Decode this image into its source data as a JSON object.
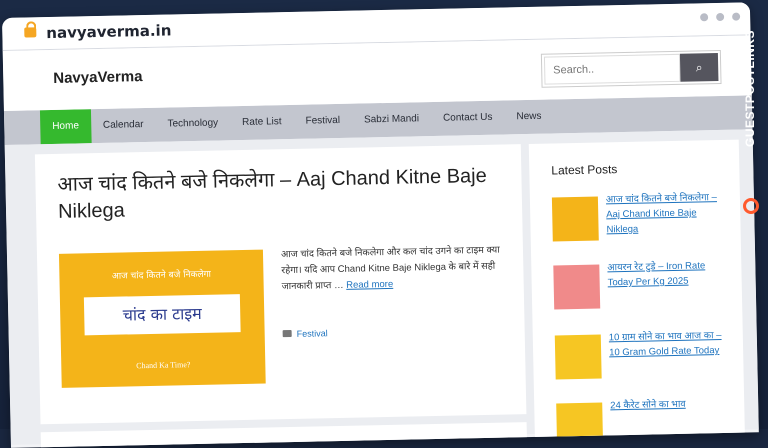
{
  "browser": {
    "url": "navyaverma.in"
  },
  "site": {
    "logo": "NavyaVerma",
    "search_placeholder": "Search..",
    "search_button": "⌕"
  },
  "nav": [
    "Home",
    "Calendar",
    "Technology",
    "Rate List",
    "Festival",
    "Sabzi Mandi",
    "Contact Us",
    "News"
  ],
  "article": {
    "title": "आज चांद कितने बजे निकलेगा – Aaj Chand Kitne Baje Niklega",
    "thumb_small": "आज चांद कितने बजे निकलेगा",
    "thumb_main": "चांद का टाइम",
    "thumb_foot": "Chand Ka Time?",
    "excerpt": "आज चांद कितने बजे निकलेगा और कल चांद उगने का टाइम क्या रहेगा। यदि आप Chand Kitne Baje Niklega के बारे में सही जानकारी प्राप्त …",
    "read_more": "Read more",
    "category": "Festival"
  },
  "sidebar": {
    "title": "Latest Posts",
    "posts": [
      {
        "title": "आज चांद कितने बजे निकलेगा – Aaj Chand Kitne Baje Niklega",
        "color": "#f4b419"
      },
      {
        "title": "आयरन रेट टुडे – Iron Rate Today Per Kg 2025",
        "color": "#f08a8a"
      },
      {
        "title": "10 ग्राम सोने का भाव आज का – 10 Gram Gold Rate Today",
        "color": "#f6c623"
      },
      {
        "title": "24 कैरेट सोने का भाव",
        "color": "#f6c623"
      }
    ]
  },
  "badge": {
    "text": "GUESTPOSTLINKS"
  }
}
